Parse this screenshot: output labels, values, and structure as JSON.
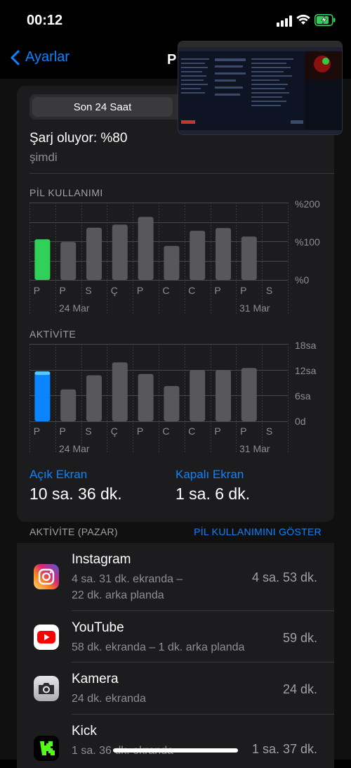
{
  "status": {
    "time": "00:12"
  },
  "nav": {
    "back_label": "Ayarlar",
    "title_partial": "P"
  },
  "segment": {
    "selected": "Son 24 Saat"
  },
  "charge": {
    "title": "Şarj oluyor: %80",
    "subtitle": "şimdi"
  },
  "battery_chart": {
    "label": "PİL KULLANIMI",
    "y_ticks": [
      "%200",
      "%100",
      "%0"
    ],
    "days": [
      "P",
      "P",
      "S",
      "Ç",
      "P",
      "C",
      "C",
      "P",
      "P",
      "S"
    ],
    "dates": [
      "24 Mar",
      "31 Mar"
    ]
  },
  "activity_chart": {
    "label": "AKTİVİTE",
    "y_ticks": [
      "18sa",
      "12sa",
      "6sa",
      "0d"
    ],
    "days": [
      "P",
      "P",
      "S",
      "Ç",
      "P",
      "C",
      "C",
      "P",
      "P",
      "S"
    ],
    "dates": [
      "24 Mar",
      "31 Mar"
    ]
  },
  "chart_data": [
    {
      "type": "bar",
      "title": "PİL KULLANIMI",
      "categories": [
        "P",
        "P",
        "S",
        "Ç",
        "P",
        "C",
        "C",
        "P",
        "P",
        "S"
      ],
      "values": [
        105,
        98,
        135,
        143,
        163,
        88,
        127,
        134,
        112,
        0
      ],
      "ylim": [
        0,
        200
      ],
      "highlight_index": 0,
      "highlight_color": "#30d158",
      "bar_color": "#58585c"
    },
    {
      "type": "bar",
      "title": "AKTİVİTE",
      "categories": [
        "P",
        "P",
        "S",
        "Ç",
        "P",
        "C",
        "C",
        "P",
        "P",
        "S"
      ],
      "values": [
        11.6,
        7.4,
        10.7,
        13.7,
        11.0,
        8.2,
        11.9,
        11.9,
        12.4,
        0
      ],
      "ylim": [
        0,
        18
      ],
      "highlight_index": 0,
      "highlight_color": "#0a84ff",
      "highlight_top_color": "#5ac8fa",
      "bar_color": "#58585c"
    }
  ],
  "screen": {
    "on_label": "Açık Ekran",
    "on_value": "10 sa. 36 dk.",
    "off_label": "Kapalı Ekran",
    "off_value": "1 sa. 6 dk."
  },
  "list_header": {
    "left": "AKTİVİTE (PAZAR)",
    "right": "PİL KULLANIMINI GÖSTER"
  },
  "apps": [
    {
      "name": "Instagram",
      "detail_line1": "4 sa. 31 dk. ekranda –",
      "detail_line2": "22 dk. arka planda",
      "total": "4 sa. 53 dk.",
      "icon": "instagram-icon"
    },
    {
      "name": "YouTube",
      "detail_line1": "58 dk. ekranda – 1 dk. arka planda",
      "detail_line2": "",
      "total": "59 dk.",
      "icon": "youtube-icon"
    },
    {
      "name": "Kamera",
      "detail_line1": "24 dk. ekranda",
      "detail_line2": "",
      "total": "24 dk.",
      "icon": "camera-icon"
    },
    {
      "name": "Kick",
      "detail_line1": "1 sa. 36 dk. ekranda",
      "detail_line2": "",
      "total": "1 sa. 37 dk.",
      "icon": "kick-icon"
    }
  ],
  "colors": {
    "accent": "#0a84ff",
    "green": "#30d158",
    "panel": "#1c1c1e"
  }
}
